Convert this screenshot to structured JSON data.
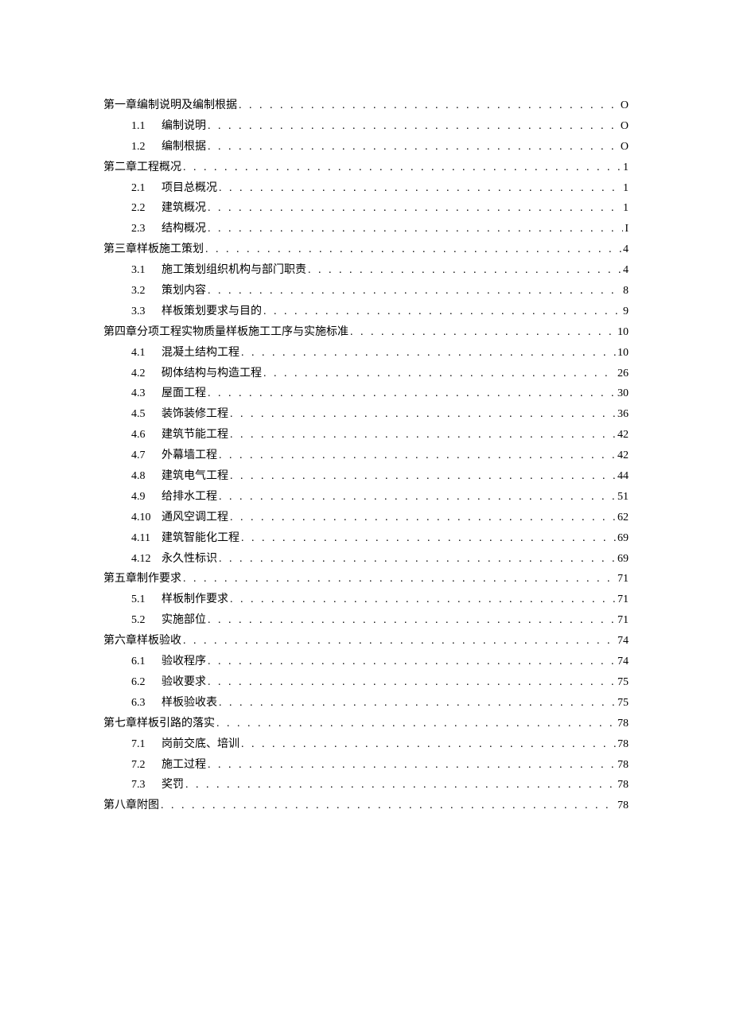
{
  "toc": [
    {
      "level": 1,
      "num": "",
      "text": "第一章编制说明及编制根据",
      "page": "O"
    },
    {
      "level": 2,
      "num": "1.1",
      "text": "编制说明",
      "page": "O"
    },
    {
      "level": 2,
      "num": "1.2",
      "text": "编制根据",
      "page": "O"
    },
    {
      "level": 1,
      "num": "",
      "text": "第二章工程概况",
      "page": "1"
    },
    {
      "level": 2,
      "num": "2.1",
      "text": "项目总概况",
      "page": "1"
    },
    {
      "level": 2,
      "num": "2.2",
      "text": "建筑概况",
      "page": "1"
    },
    {
      "level": 2,
      "num": "2.3",
      "text": "结构概况",
      "page": "I"
    },
    {
      "level": 1,
      "num": "",
      "text": "第三章样板施工策划",
      "page": "4"
    },
    {
      "level": 2,
      "num": "3.1",
      "text": "施工策划组织机构与部门职责",
      "page": "4"
    },
    {
      "level": 2,
      "num": "3.2",
      "text": "策划内容",
      "page": "8"
    },
    {
      "level": 2,
      "num": "3.3",
      "text": "样板策划要求与目的",
      "page": "9"
    },
    {
      "level": 1,
      "num": "",
      "text": "第四章分项工程实物质量样板施工工序与实施标准",
      "page": "10"
    },
    {
      "level": 2,
      "num": "4.1",
      "text": "混凝土结构工程",
      "page": "10"
    },
    {
      "level": 2,
      "num": "4.2",
      "text": "砌体结构与构造工程",
      "page": "26"
    },
    {
      "level": 2,
      "num": "4.3",
      "text": "屋面工程",
      "page": "30"
    },
    {
      "level": 2,
      "num": "4.5",
      "text": "装饰装修工程",
      "page": "36"
    },
    {
      "level": 2,
      "num": "4.6",
      "text": "建筑节能工程",
      "page": "42"
    },
    {
      "level": 2,
      "num": "4.7",
      "text": "外幕墙工程",
      "page": "42"
    },
    {
      "level": 2,
      "num": "4.8",
      "text": "建筑电气工程",
      "page": "44"
    },
    {
      "level": 2,
      "num": "4.9",
      "text": "给排水工程",
      "page": "51"
    },
    {
      "level": 2,
      "num": "4.10",
      "text": "通风空调工程",
      "page": "62"
    },
    {
      "level": 2,
      "num": "4.11",
      "text": "建筑智能化工程",
      "page": "69"
    },
    {
      "level": 2,
      "num": "4.12",
      "text": "永久性标识",
      "page": "69"
    },
    {
      "level": 1,
      "num": "",
      "text": "第五章制作要求",
      "page": "71"
    },
    {
      "level": 2,
      "num": "5.1",
      "text": "样板制作要求",
      "page": "71"
    },
    {
      "level": 2,
      "num": "5.2",
      "text": "实施部位",
      "page": "71"
    },
    {
      "level": 1,
      "num": "",
      "text": "第六章样板验收",
      "page": "74"
    },
    {
      "level": 2,
      "num": "6.1",
      "text": "验收程序",
      "page": "74"
    },
    {
      "level": 2,
      "num": "6.2",
      "text": "验收要求",
      "page": "75"
    },
    {
      "level": 2,
      "num": "6.3",
      "text": "样板验收表",
      "page": "75"
    },
    {
      "level": 1,
      "num": "",
      "text": "第七章样板引路的落实",
      "page": "78"
    },
    {
      "level": 2,
      "num": "7.1",
      "text": "岗前交底、培训",
      "page": "78"
    },
    {
      "level": 2,
      "num": "7.2",
      "text": "施工过程",
      "page": "78"
    },
    {
      "level": 2,
      "num": "7.3",
      "text": "奖罚",
      "page": "78"
    },
    {
      "level": 1,
      "num": "",
      "text": "第八章附图",
      "page": "78"
    }
  ]
}
